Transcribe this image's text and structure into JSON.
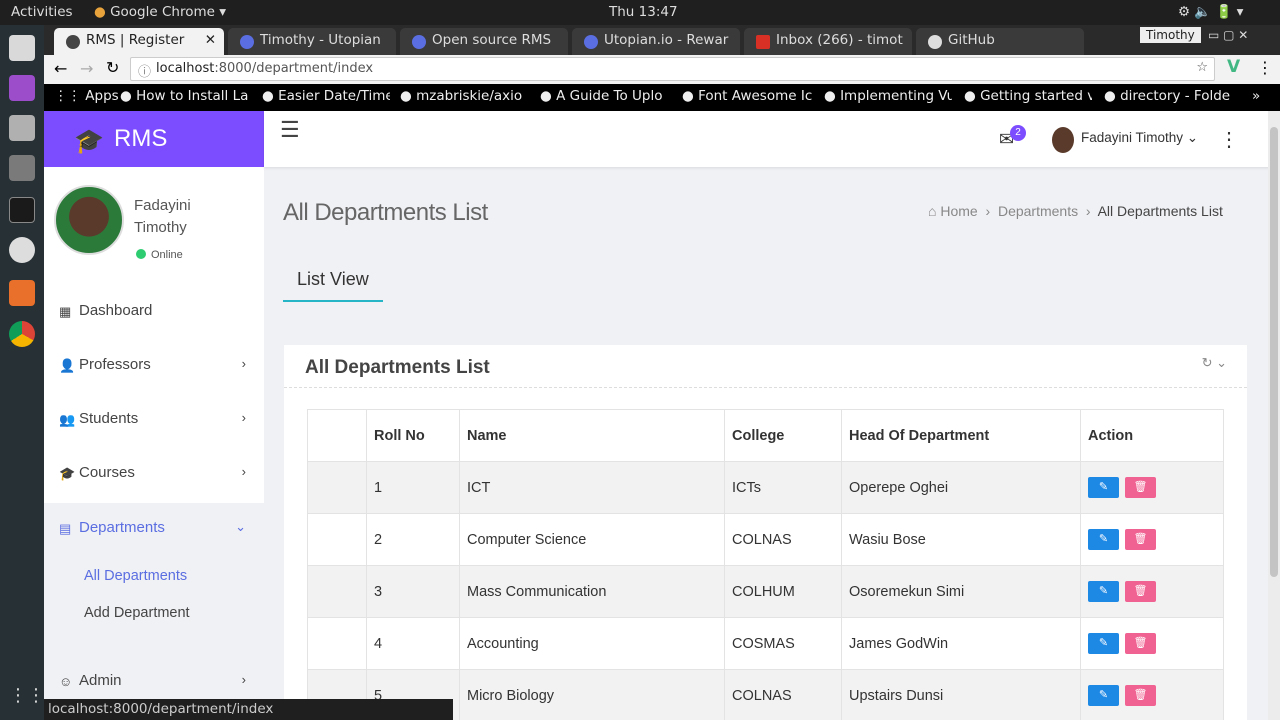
{
  "os": {
    "activities": "Activities",
    "app": "Google Chrome",
    "clock": "Thu 13:47"
  },
  "browser": {
    "tabs": [
      {
        "title": "RMS | Register"
      },
      {
        "title": "Timothy - Utopian"
      },
      {
        "title": "Open source RMS"
      },
      {
        "title": "Utopian.io - Rewar"
      },
      {
        "title": "Inbox (266) - timot"
      },
      {
        "title": "GitHub"
      }
    ],
    "profile": "Timothy",
    "url_host": "localhost",
    "url_path": ":8000/department/index",
    "bookmarks": [
      "Apps",
      "How to Install La",
      "Easier Date/Time",
      "mzabriskie/axio",
      "A Guide To Uplo",
      "Font Awesome Ic",
      "Implementing Vu",
      "Getting started v",
      "directory - Folde"
    ],
    "status_url": "localhost:8000/department/index"
  },
  "app": {
    "brand": "RMS",
    "user": {
      "name": "Fadayini Timothy",
      "status": "Online"
    },
    "nav": [
      {
        "label": "Dashboard"
      },
      {
        "label": "Professors"
      },
      {
        "label": "Students"
      },
      {
        "label": "Courses"
      },
      {
        "label": "Departments"
      },
      {
        "label": "Admin"
      }
    ],
    "subnav": [
      "All Departments",
      "Add Department"
    ],
    "header": {
      "mail_count": "2",
      "user": "Fadayini Timothy"
    },
    "page_title": "All Departments List",
    "breadcrumb": {
      "home": "Home",
      "section": "Departments",
      "current": "All Departments List"
    },
    "list_view_tab": "List View",
    "card_title": "All Departments List",
    "table": {
      "headers": [
        "",
        "Roll No",
        "Name",
        "College",
        "Head Of Department",
        "Action"
      ],
      "rows": [
        {
          "roll": "1",
          "name": "ICT",
          "college": "ICTs",
          "hod": "Operepe Oghei"
        },
        {
          "roll": "2",
          "name": "Computer Science",
          "college": "COLNAS",
          "hod": "Wasiu Bose"
        },
        {
          "roll": "3",
          "name": "Mass Communication",
          "college": "COLHUM",
          "hod": "Osoremekun Simi"
        },
        {
          "roll": "4",
          "name": "Accounting",
          "college": "COSMAS",
          "hod": "James GodWin"
        },
        {
          "roll": "5",
          "name": "Micro Biology",
          "college": "COLNAS",
          "hod": "Upstairs Dunsi"
        }
      ]
    }
  },
  "colors": {
    "brand": "#7c4dff",
    "accent": "#5b6ee1",
    "edit": "#1e88e5",
    "delete": "#f06292",
    "tab_underline": "#26b5c7"
  }
}
